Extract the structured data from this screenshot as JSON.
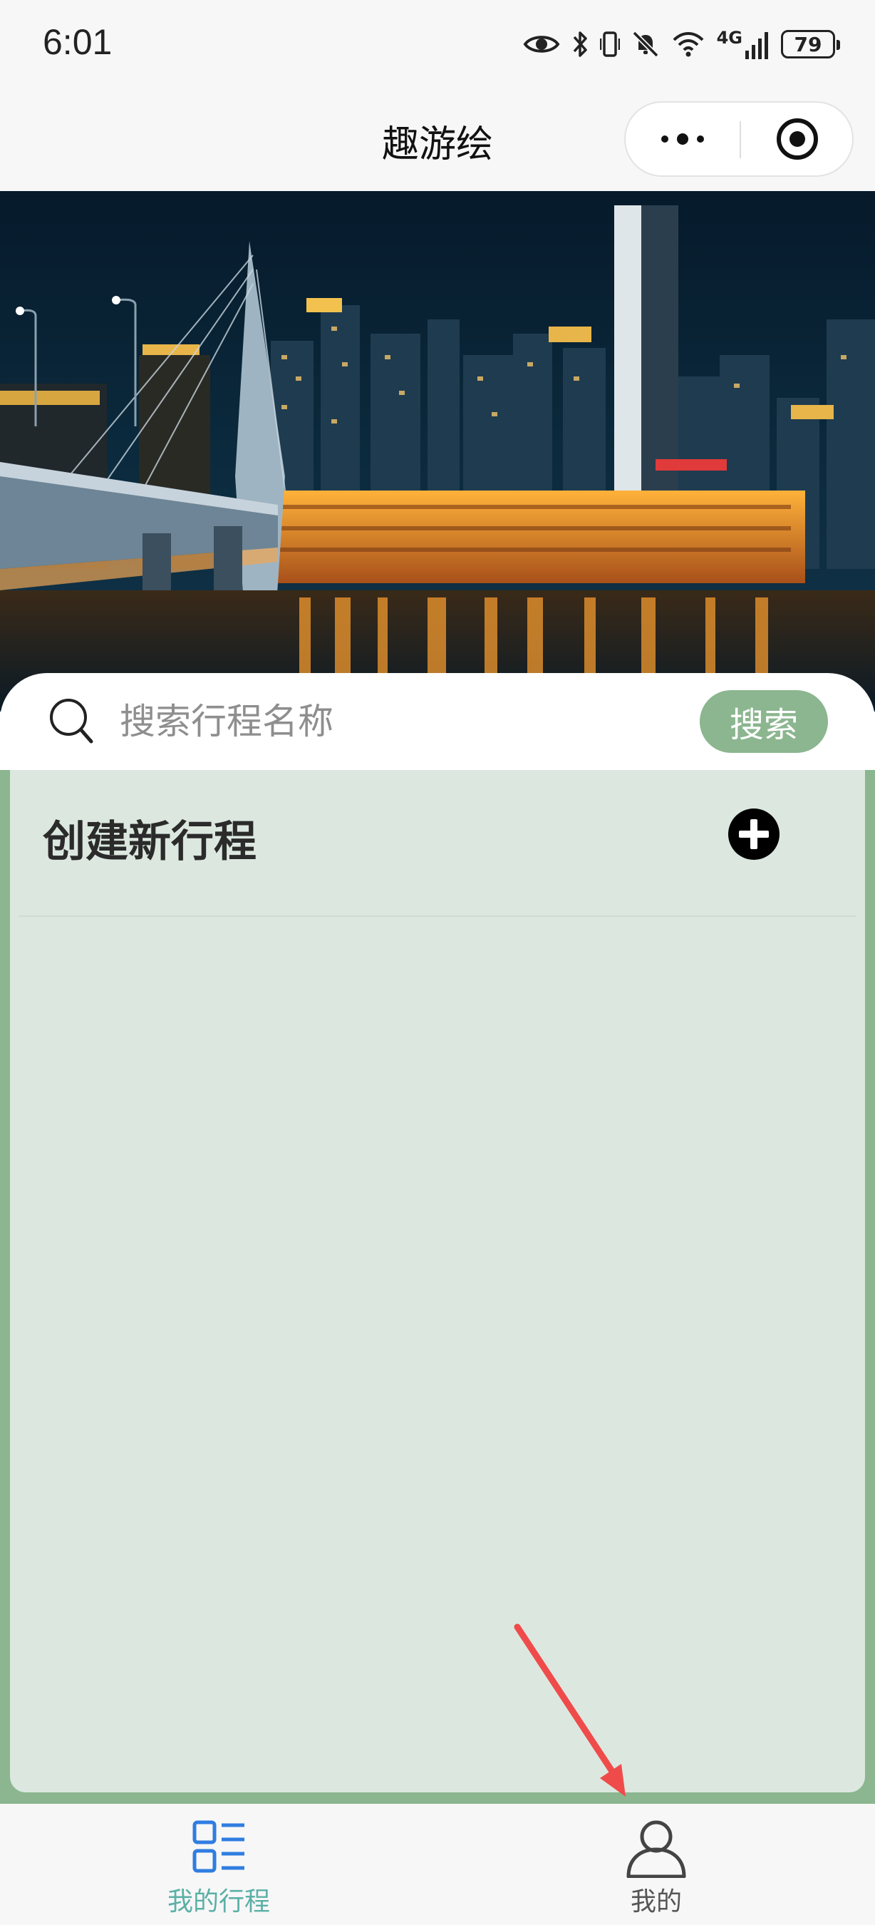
{
  "status_bar": {
    "time": "6:01",
    "network": "4G",
    "battery": "79",
    "icons": [
      "eye-icon",
      "bluetooth-icon",
      "vibrate-icon",
      "mute-icon",
      "wifi-icon",
      "signal-icon",
      "battery-icon"
    ]
  },
  "header": {
    "title": "趣游绘",
    "capsule_icons": [
      "more-dots-icon",
      "close-target-icon"
    ]
  },
  "banner": {
    "image": "night city skyline with bridge and river reflection"
  },
  "search": {
    "placeholder": "搜索行程名称",
    "value": "",
    "button_label": "搜索",
    "icon": "search-icon",
    "button_color": "#8bb68f"
  },
  "trips": {
    "create_label": "创建新行程",
    "create_icon": "plus-circle-icon",
    "items": []
  },
  "tabbar": {
    "tabs": [
      {
        "label": "我的行程",
        "icon": "list-icon",
        "active": true
      },
      {
        "label": "我的",
        "icon": "user-icon",
        "active": false
      }
    ],
    "active_color": "#5bb0a6"
  },
  "annotation": {
    "type": "arrow",
    "color": "#f04b4b",
    "points_to": "我的"
  },
  "colors": {
    "accent": "#8bb68f",
    "panel": "#dce8df",
    "background": "#f7f7f7"
  }
}
